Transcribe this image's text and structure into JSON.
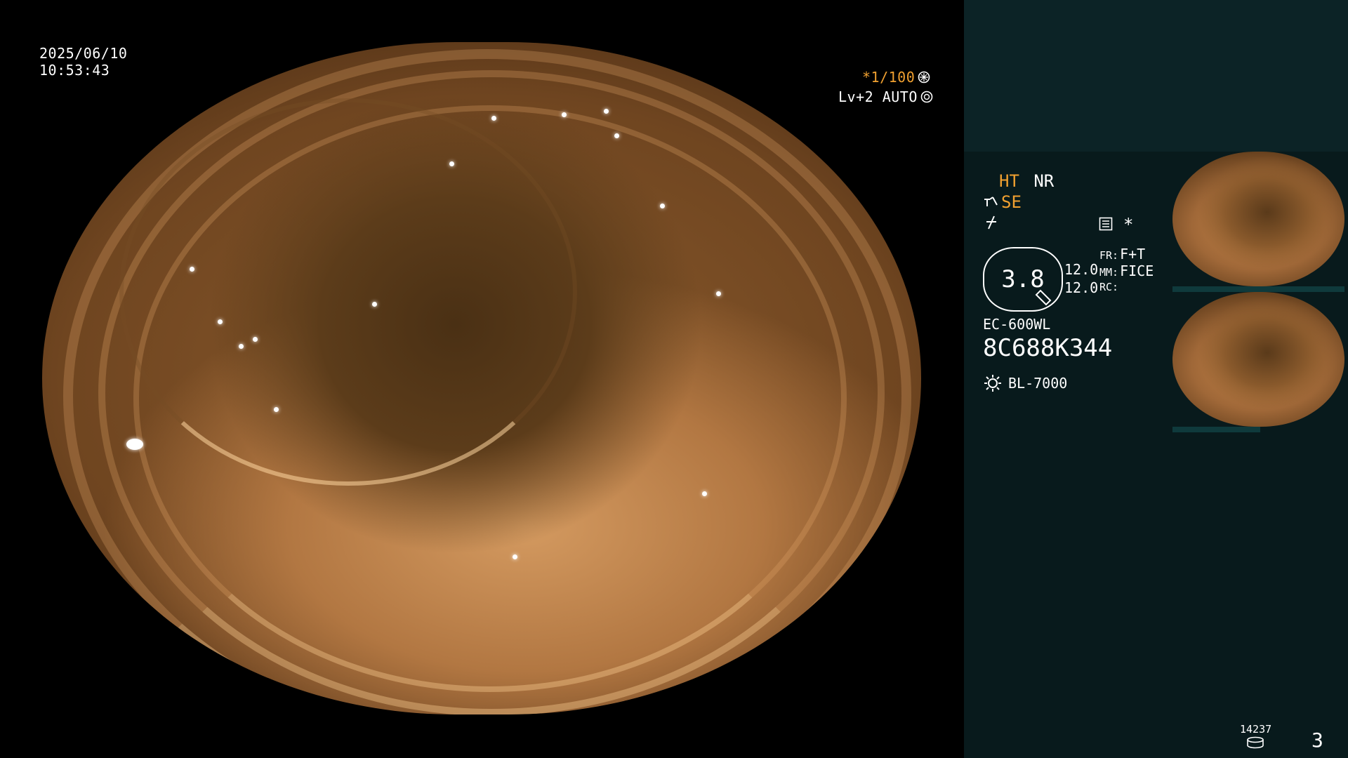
{
  "overlay": {
    "date": "2025/06/10",
    "time": "10:53:43",
    "shutter": "*1/100",
    "shutter_icon": "aperture-icon",
    "level": "Lv+2 AUTO",
    "level_icon": "iris-icon"
  },
  "panel": {
    "ht_label": "HT",
    "nr_label": "NR",
    "se_label": "SE",
    "zoom_value": "3.8",
    "zoom_row1": "12.0",
    "zoom_row2": "12.0",
    "fr_key": "FR:",
    "fr_val": "F+T",
    "mm_key": "MM:",
    "mm_val": "FICE",
    "rc_key": "RC:",
    "rc_val": "",
    "asterisk": "*",
    "scope_model": "EC-600WL",
    "scope_serial": "8C688K344",
    "light_source": "BL-7000",
    "counter": "14237",
    "page_number": "3"
  },
  "thumbnails": [
    {
      "label": "capture-1"
    },
    {
      "label": "capture-2"
    }
  ],
  "colors": {
    "accent_orange": "#f0a030",
    "panel_top": "#0c2326",
    "panel_bg": "#081a1c"
  }
}
